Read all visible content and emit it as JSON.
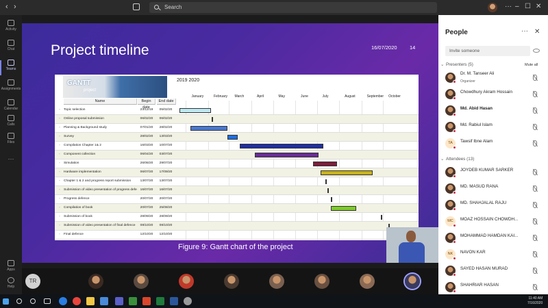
{
  "window": {
    "search_placeholder": "Search",
    "controls": [
      "···",
      "–",
      "☐",
      "✕"
    ]
  },
  "rail": [
    {
      "label": "Activity",
      "icon": "bell-icon"
    },
    {
      "label": "Chat",
      "icon": "chat-icon"
    },
    {
      "label": "Teams",
      "icon": "teams-icon",
      "active": true
    },
    {
      "label": "Assignments",
      "icon": "assignments-icon"
    },
    {
      "label": "Calendar",
      "icon": "calendar-icon"
    },
    {
      "label": "Calls",
      "icon": "phone-icon"
    },
    {
      "label": "Files",
      "icon": "file-icon"
    },
    {
      "label": "···",
      "icon": "more-icon"
    },
    {
      "label": "Apps",
      "icon": "apps-icon"
    },
    {
      "label": "Help",
      "icon": "help-icon"
    }
  ],
  "slide": {
    "title": "Project timeline",
    "date": "16/07/2020",
    "number": "14",
    "caption": "Figure 9: Gantt chart of the project"
  },
  "gantt": {
    "logo_text": "GANTT",
    "logo_sub": "project",
    "year_label": "2019 2020",
    "col_name": "Name",
    "col_begin": "Begin date",
    "col_end": "End date",
    "months": [
      "January",
      "February",
      "March",
      "April",
      "May",
      "June",
      "July",
      "August",
      "September",
      "October"
    ],
    "tasks": [
      {
        "name": "Topic selection",
        "begin": "23/12/19",
        "end": "05/02/20",
        "color": "#bde9f2"
      },
      {
        "name": "Online proposal submission",
        "begin": "06/02/20",
        "end": "06/02/20",
        "color": "#9a9a9a"
      },
      {
        "name": "Planning & Background study",
        "begin": "07/01/20",
        "end": "28/02/20",
        "color": "#4a78d0"
      },
      {
        "name": "Survey",
        "begin": "28/02/20",
        "end": "13/03/20",
        "color": "#1b6ee8"
      },
      {
        "name": "Compilation Chapter 1& 2",
        "begin": "16/03/20",
        "end": "10/07/20",
        "color": "#1f2f9f"
      },
      {
        "name": "Component collection",
        "begin": "06/04/20",
        "end": "03/07/20",
        "color": "#6a2c9a"
      },
      {
        "name": "Simulation",
        "begin": "26/06/20",
        "end": "29/07/20",
        "color": "#7a1f3a"
      },
      {
        "name": "Hardware implementation",
        "begin": "06/07/20",
        "end": "17/09/20",
        "color": "#c8b21a"
      },
      {
        "name": "Chapter 1 & 2 and progress report submission",
        "begin": "13/07/20",
        "end": "13/07/20",
        "color": "#9a9a9a"
      },
      {
        "name": "Submission of video presentation of progress defence",
        "begin": "16/07/20",
        "end": "16/07/20",
        "color": "#9a9a9a"
      },
      {
        "name": "Progress defence",
        "begin": "20/07/20",
        "end": "20/07/20",
        "color": "#9a9a9a"
      },
      {
        "name": "Compilation of book",
        "begin": "20/07/20",
        "end": "25/08/20",
        "color": "#7fcc2a"
      },
      {
        "name": "Submission of book",
        "begin": "28/09/20",
        "end": "28/09/20",
        "color": "#9a9a9a"
      },
      {
        "name": "Submission of video presentation of final defence",
        "begin": "08/10/20",
        "end": "08/10/20",
        "color": "#9a9a9a"
      },
      {
        "name": "Final defence",
        "begin": "12/10/20",
        "end": "12/10/20",
        "color": "#9a9a9a"
      }
    ]
  },
  "strip": [
    {
      "initials": "TR"
    },
    {
      "initials": ""
    },
    {
      "initials": ""
    },
    {
      "initials": ""
    },
    {
      "initials": ""
    },
    {
      "initials": ""
    },
    {
      "initials": ""
    },
    {
      "initials": ""
    },
    {
      "initials": ""
    }
  ],
  "panel": {
    "title": "People",
    "invite_placeholder": "Invite someone",
    "presenters_label": "Presenters (5)",
    "mute_all": "Mute all",
    "attendees_label": "Attendees (13)",
    "presenters": [
      {
        "name": "Dr. M. Tanseer Ali",
        "role": "Organizer",
        "initials": ""
      },
      {
        "name": "Chowdhury Akram Hossain",
        "role": "",
        "initials": ""
      },
      {
        "name": "Md. Abid Hasan",
        "role": "",
        "initials": "",
        "bold": true
      },
      {
        "name": "Md. Rabiul Islam",
        "role": "",
        "initials": ""
      },
      {
        "name": "Tawsif Ibne Alam",
        "role": "",
        "initials": "TA"
      }
    ],
    "attendees": [
      {
        "name": "JOYDEB KUMAR SARKER",
        "initials": ""
      },
      {
        "name": "MD. MASUD RANA",
        "initials": ""
      },
      {
        "name": "MD. SHAHJALAL RAJU",
        "initials": ""
      },
      {
        "name": "MOAZ HOSSAIN CHOWDH...",
        "initials": "MC"
      },
      {
        "name": "MOHAMMAD HAMDAN KAI...",
        "initials": ""
      },
      {
        "name": "NAVON KAR",
        "initials": "NK"
      },
      {
        "name": "SAYED HASAN MURAD",
        "initials": ""
      },
      {
        "name": "SHAHRIAR HASAN",
        "initials": ""
      }
    ]
  },
  "taskbar": {
    "time": "11:40 AM",
    "date": "7/16/2020"
  }
}
